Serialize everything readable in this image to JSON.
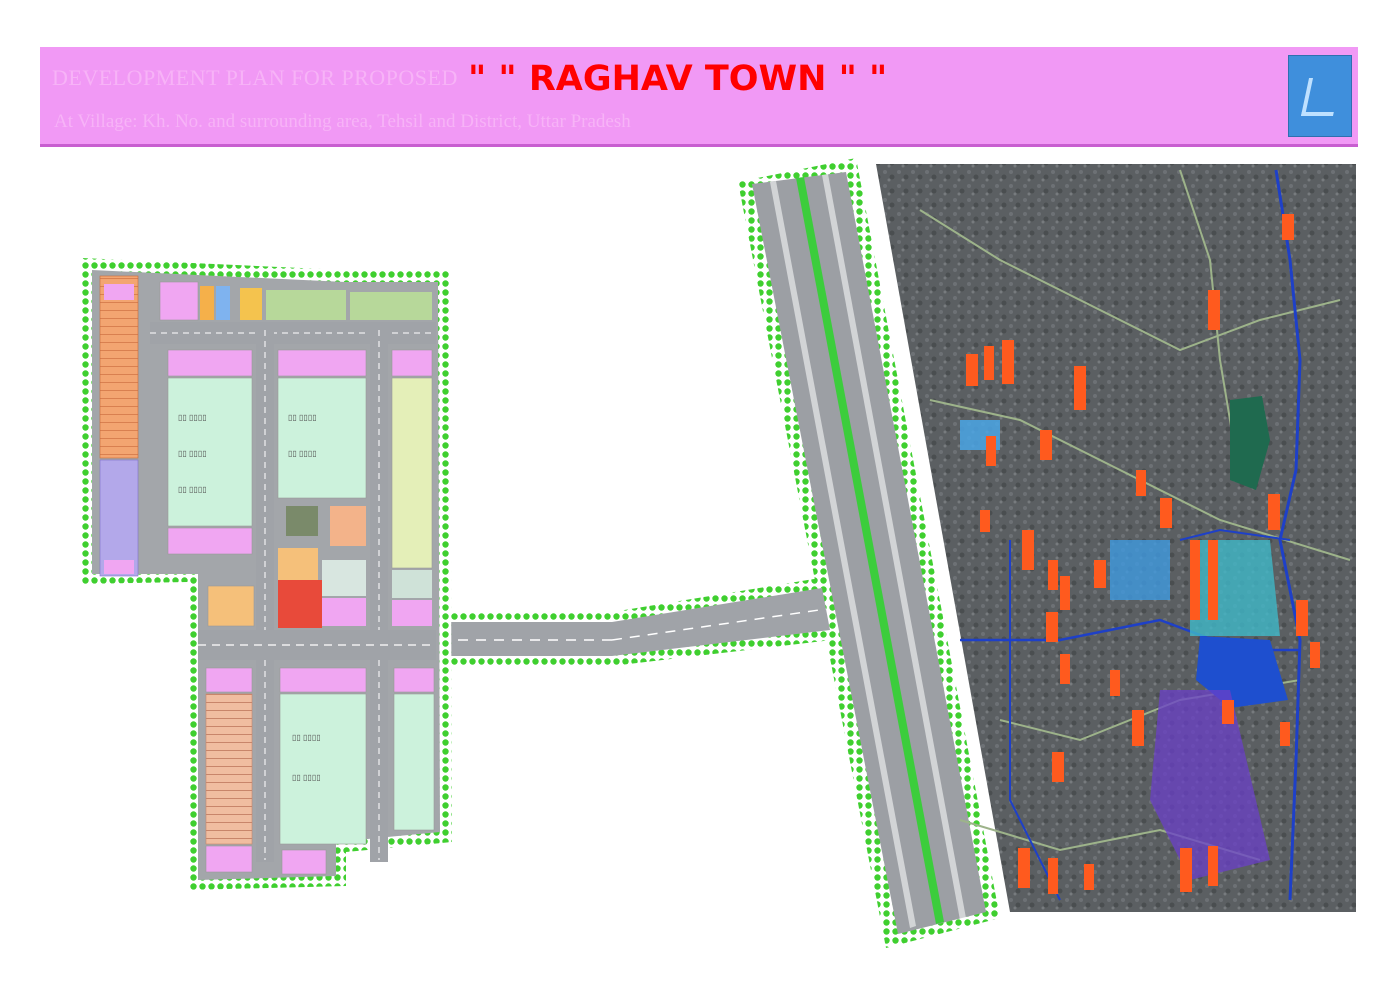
{
  "banner": {
    "lead": "DEVELOPMENT PLAN FOR PROPOSED",
    "title": "\" \" RAGHAV TOWN \" \"",
    "subtitle": "At Village: Kh. No. and surrounding area, Tehsil and District, Uttar Pradesh",
    "colors": {
      "background": "#f199f5",
      "title": "#ff0000"
    }
  },
  "logo": {
    "icon": "company-logo-icon"
  },
  "layout_plan": {
    "colors": {
      "boundary_hedge": "#3fcf2f",
      "road": "#a0a3a8",
      "park": "#ccf2dc",
      "commercial": "#f5c07a"
    }
  },
  "highway": {
    "colors": {
      "median": "#3ccd3c",
      "asphalt": "#9c9fa4"
    }
  },
  "satellite": {
    "colors": {
      "plots": "#ff5a1e",
      "water": "#1e40c8"
    }
  }
}
